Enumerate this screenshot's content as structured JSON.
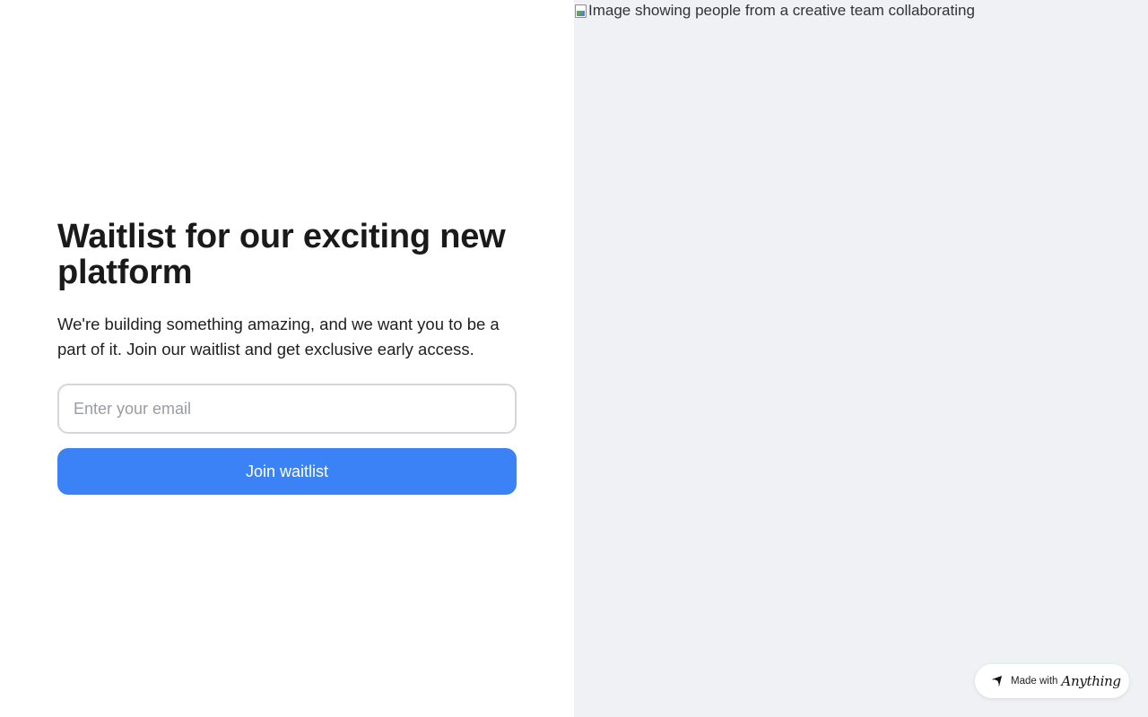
{
  "signup": {
    "headline": "Waitlist for our exciting new platform",
    "description": "We're building something amazing, and we want you to be a part of it. Join our waitlist and get exclusive early access.",
    "email_placeholder": "Enter your email",
    "email_value": "",
    "submit_label": "Join waitlist"
  },
  "hero": {
    "image_alt": "Image showing people from a creative team collaborating"
  },
  "badge": {
    "prefix": "Made with",
    "brand": "Anything",
    "icon": "anything-logo-icon"
  },
  "colors": {
    "accent": "#3b82f6",
    "right_pane_bg": "#eff1f5",
    "text": "#1a1a1a"
  }
}
